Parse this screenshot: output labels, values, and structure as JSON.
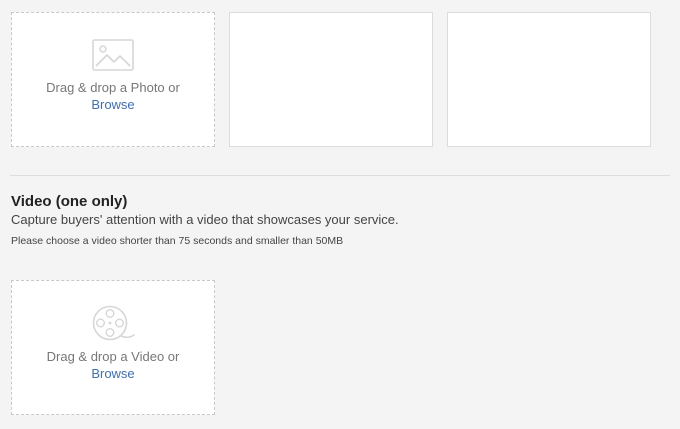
{
  "photos": {
    "dropzone": {
      "icon": "image-icon",
      "text": "Drag & drop a Photo or",
      "browse_label": "Browse"
    },
    "slots": 2
  },
  "video": {
    "title": "Video (one only)",
    "description": "Capture buyers' attention with a video that showcases your service.",
    "note": "Please choose a video shorter than 75 seconds and smaller than 50MB",
    "dropzone": {
      "icon": "film-reel-icon",
      "text": "Drag & drop a Video or",
      "browse_label": "Browse"
    }
  },
  "colors": {
    "background": "#f4f4f4",
    "link": "#3f6fb5",
    "muted_text": "#777777"
  }
}
